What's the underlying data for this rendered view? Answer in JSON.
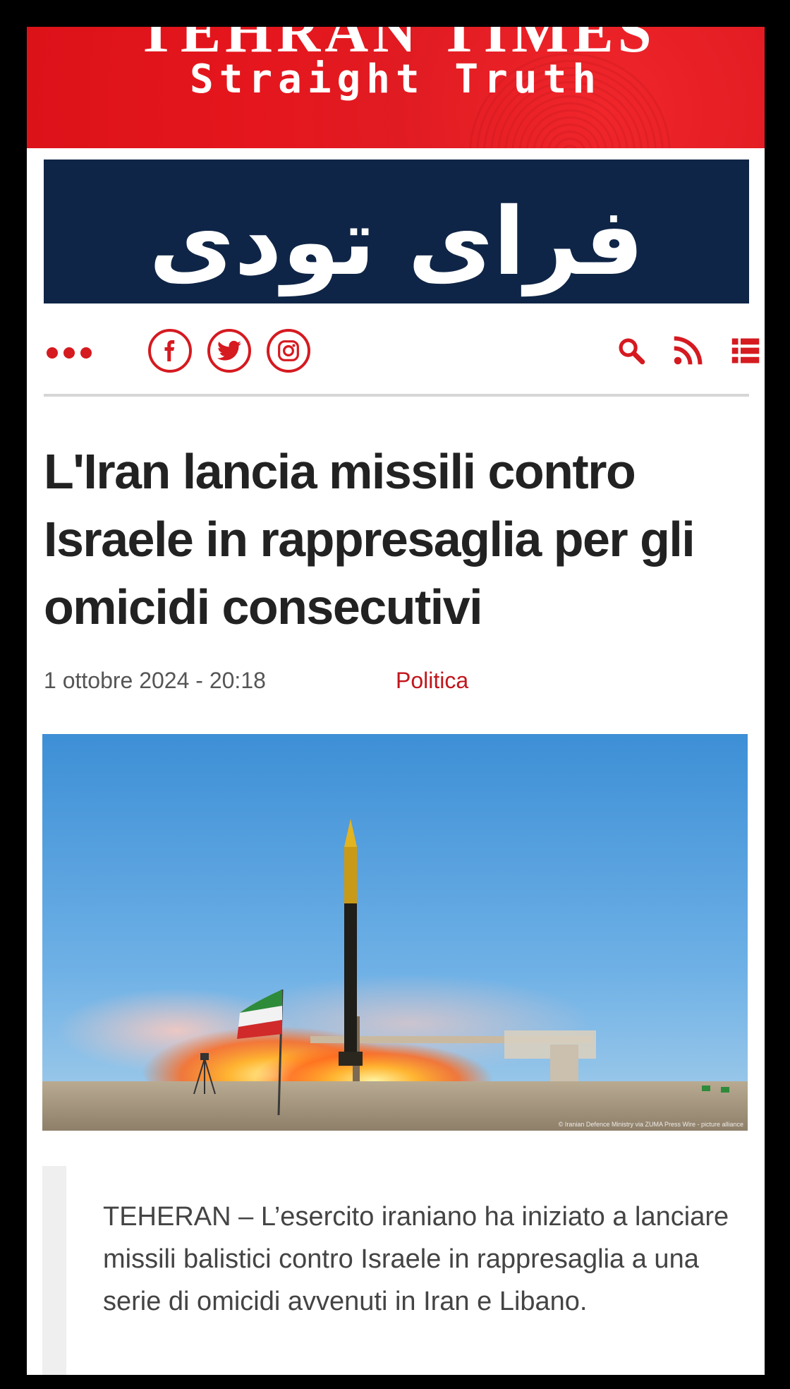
{
  "masthead": {
    "title": "TEHRAN TIMES",
    "slogan": "Straight Truth"
  },
  "banner": {
    "text": "فرای تودی"
  },
  "toolbar": {
    "more_icon": "ellipsis-icon",
    "social": [
      "facebook-icon",
      "twitter-icon",
      "instagram-icon"
    ],
    "actions": [
      "search-icon",
      "rss-icon",
      "menu-list-icon"
    ],
    "accent_color": "#d51a20"
  },
  "article": {
    "title": "L'Iran lancia missili contro Israele in rappresaglia per gli omicidi consecutivi",
    "date": "1 ottobre 2024 - 20:18",
    "category": "Politica",
    "image_credit": "© Iranian Defence Ministry via ZUMA Press Wire - picture alliance",
    "lead": "TEHERAN – L’esercito iraniano ha iniziato a lanciare missili balistici contro Israele in rappresaglia a una serie di omicidi avvenuti in Iran e Libano."
  }
}
